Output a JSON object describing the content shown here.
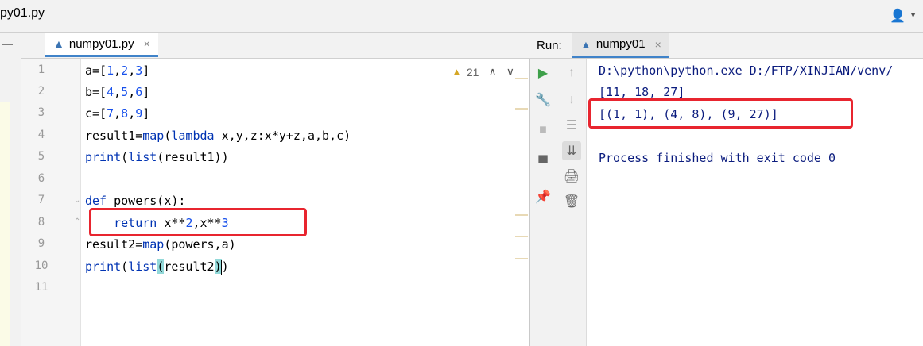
{
  "window": {
    "title_tab": "py01.py"
  },
  "editor": {
    "tab": {
      "label": "numpy01.py",
      "close": "×"
    },
    "inspection": {
      "warning_count": "21",
      "prev": "∧",
      "next": "∨"
    },
    "line_numbers": [
      "1",
      "2",
      "3",
      "4",
      "5",
      "6",
      "7",
      "8",
      "9",
      "10",
      "11"
    ],
    "current_line": "10"
  },
  "run": {
    "label": "Run:",
    "tab": {
      "label": "numpy01",
      "close": "×"
    },
    "output": {
      "cmd": "D:\\python\\python.exe D:/FTP/XINJIAN/venv/",
      "line2": "[11, 18, 27]",
      "line3": "[(1, 1), (4, 8), (9, 27)]",
      "finished": "Process finished with exit code 0"
    }
  },
  "colors": {
    "annotation_box": "#e8252f",
    "keyword": "#0033b3",
    "number": "#1750eb",
    "output_text": "#0b1c7e"
  }
}
